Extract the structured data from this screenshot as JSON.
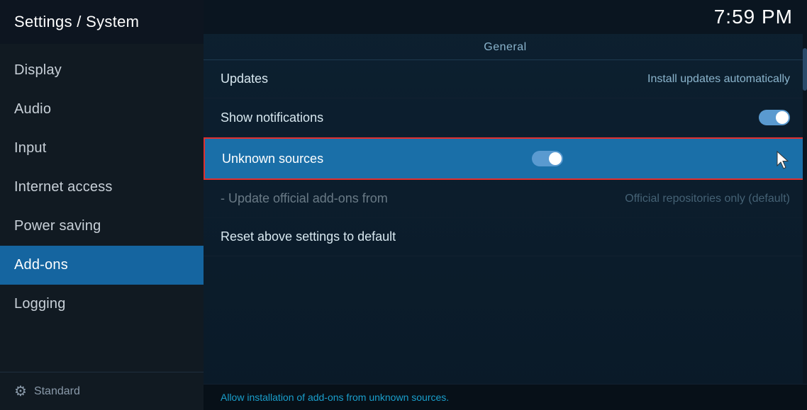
{
  "sidebar": {
    "title": "Settings / System",
    "items": [
      {
        "id": "display",
        "label": "Display",
        "active": false
      },
      {
        "id": "audio",
        "label": "Audio",
        "active": false
      },
      {
        "id": "input",
        "label": "Input",
        "active": false
      },
      {
        "id": "internet-access",
        "label": "Internet access",
        "active": false
      },
      {
        "id": "power-saving",
        "label": "Power saving",
        "active": false
      },
      {
        "id": "add-ons",
        "label": "Add-ons",
        "active": true
      },
      {
        "id": "logging",
        "label": "Logging",
        "active": false
      }
    ],
    "footer": {
      "label": "Standard",
      "icon": "gear"
    }
  },
  "clock": "7:59 PM",
  "main": {
    "section_header": "General",
    "settings": [
      {
        "id": "updates",
        "label": "Updates",
        "value": "Install updates automatically",
        "type": "text",
        "highlighted": false,
        "dimmed": false
      },
      {
        "id": "show-notifications",
        "label": "Show notifications",
        "value": null,
        "type": "toggle",
        "toggle_on": true,
        "highlighted": false,
        "dimmed": false
      },
      {
        "id": "unknown-sources",
        "label": "Unknown sources",
        "value": null,
        "type": "toggle",
        "toggle_on": true,
        "highlighted": true,
        "dimmed": false
      },
      {
        "id": "update-official-addons",
        "label": "- Update official add-ons from",
        "value": "Official repositories only (default)",
        "type": "text",
        "highlighted": false,
        "dimmed": true
      },
      {
        "id": "reset-settings",
        "label": "Reset above settings to default",
        "value": null,
        "type": "text",
        "highlighted": false,
        "dimmed": false
      }
    ],
    "bottom_text": "Allow installation of add-ons from unknown sources."
  }
}
